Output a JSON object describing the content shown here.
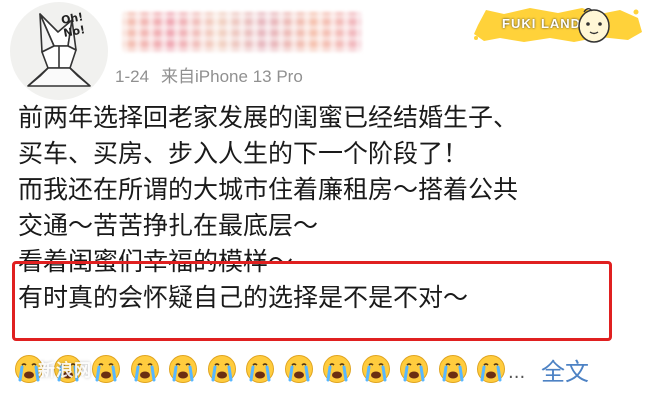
{
  "avatar": {
    "caption": "Oh! No!"
  },
  "post_meta": {
    "date": "1-24",
    "source": "来自iPhone 13 Pro"
  },
  "badge": {
    "text": "FUKI LAND",
    "color": "#ffd23a"
  },
  "post": {
    "lines": [
      "前两年选择回老家发展的闺蜜已经结婚生子、",
      "买车、买房、步入人生的下一个阶段了！",
      "而我还在所谓的大城市住着廉租房～搭着公共",
      "交通～苦苦挣扎在最底层～",
      "看着闺蜜们幸福的模样～",
      "有时真的会怀疑自己的选择是不是不对～"
    ],
    "highlight_color": "#e02020"
  },
  "footer": {
    "watermark": "新浪网",
    "emoji_icon": "crying-face-icon",
    "emoji_count": 13,
    "ellipsis": "...",
    "full_text_link": "全文",
    "link_color": "#4d82c4"
  }
}
